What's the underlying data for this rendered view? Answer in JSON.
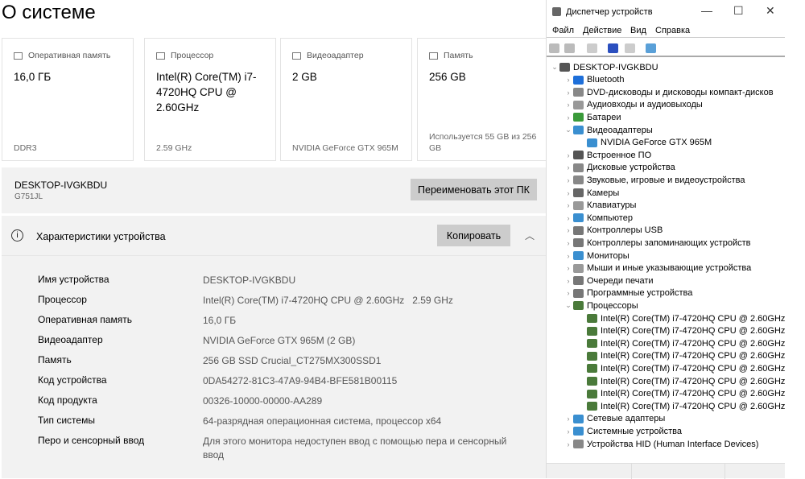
{
  "about": {
    "title": "О системе",
    "cards": [
      {
        "label": "Оперативная память",
        "value": "16,0 ГБ",
        "sub": "DDR3",
        "icon": "ram-icon"
      },
      {
        "label": "Процессор",
        "value": "Intel(R) Core(TM) i7-4720HQ CPU @ 2.60GHz",
        "sub": "2.59 GHz",
        "icon": "cpu-icon"
      },
      {
        "label": "Видеоадаптер",
        "value": "2 GB",
        "sub": "NVIDIA GeForce GTX 965M",
        "icon": "gpu-icon"
      },
      {
        "label": "Память",
        "value": "256 GB",
        "sub": "Используется 55 GB из 256 GB",
        "icon": "storage-icon"
      }
    ],
    "pc_name": "DESKTOP-IVGKBDU",
    "model": "G751JL",
    "rename_label": "Переименовать этот ПК",
    "spec_title": "Характеристики устройства",
    "copy_label": "Копировать",
    "specs": [
      {
        "k": "Имя устройства",
        "v": "DESKTOP-IVGKBDU"
      },
      {
        "k": "Процессор",
        "v": "Intel(R) Core(TM) i7-4720HQ CPU @ 2.60GHz   2.59 GHz"
      },
      {
        "k": "Оперативная память",
        "v": "16,0 ГБ"
      },
      {
        "k": "Видеоадаптер",
        "v": "NVIDIA GeForce GTX 965M (2 GB)"
      },
      {
        "k": "Память",
        "v": "256 GB SSD Crucial_CT275MX300SSD1"
      },
      {
        "k": "Код устройства",
        "v": "0DA54272-81C3-47A9-94B4-BFE581B00115"
      },
      {
        "k": "Код продукта",
        "v": "00326-10000-00000-AA289"
      },
      {
        "k": "Тип системы",
        "v": "64-разрядная операционная система, процессор x64"
      },
      {
        "k": "Перо и сенсорный ввод",
        "v": "Для этого монитора недоступен ввод с помощью пера и сенсорный ввод"
      }
    ]
  },
  "devmgr": {
    "title": "Диспетчер устройств",
    "menu": [
      "Файл",
      "Действие",
      "Вид",
      "Справка"
    ],
    "tree": [
      {
        "t": "DESKTOP-IVGKBDU",
        "l": 0,
        "e": "v",
        "c": "#555"
      },
      {
        "t": "Bluetooth",
        "l": 1,
        "e": ">",
        "c": "#1e6fd9"
      },
      {
        "t": "DVD-дисководы и дисководы компакт-дисков",
        "l": 1,
        "e": ">",
        "c": "#888"
      },
      {
        "t": "Аудиовходы и аудиовыходы",
        "l": 1,
        "e": ">",
        "c": "#999"
      },
      {
        "t": "Батареи",
        "l": 1,
        "e": ">",
        "c": "#3a9a3a"
      },
      {
        "t": "Видеоадаптеры",
        "l": 1,
        "e": "v",
        "c": "#3a8fd0"
      },
      {
        "t": "NVIDIA GeForce GTX 965M",
        "l": 2,
        "e": "",
        "c": "#3a8fd0"
      },
      {
        "t": "Встроенное ПО",
        "l": 1,
        "e": ">",
        "c": "#555"
      },
      {
        "t": "Дисковые устройства",
        "l": 1,
        "e": ">",
        "c": "#888"
      },
      {
        "t": "Звуковые, игровые и видеоустройства",
        "l": 1,
        "e": ">",
        "c": "#888"
      },
      {
        "t": "Камеры",
        "l": 1,
        "e": ">",
        "c": "#666"
      },
      {
        "t": "Клавиатуры",
        "l": 1,
        "e": ">",
        "c": "#999"
      },
      {
        "t": "Компьютер",
        "l": 1,
        "e": ">",
        "c": "#3a8fd0"
      },
      {
        "t": "Контроллеры USB",
        "l": 1,
        "e": ">",
        "c": "#777"
      },
      {
        "t": "Контроллеры запоминающих устройств",
        "l": 1,
        "e": ">",
        "c": "#777"
      },
      {
        "t": "Мониторы",
        "l": 1,
        "e": ">",
        "c": "#3a8fd0"
      },
      {
        "t": "Мыши и иные указывающие устройства",
        "l": 1,
        "e": ">",
        "c": "#999"
      },
      {
        "t": "Очереди печати",
        "l": 1,
        "e": ">",
        "c": "#777"
      },
      {
        "t": "Программные устройства",
        "l": 1,
        "e": ">",
        "c": "#777"
      },
      {
        "t": "Процессоры",
        "l": 1,
        "e": "v",
        "c": "#4a7a3a"
      },
      {
        "t": "Intel(R) Core(TM) i7-4720HQ CPU @ 2.60GHz",
        "l": 2,
        "e": "",
        "c": "#4a7a3a"
      },
      {
        "t": "Intel(R) Core(TM) i7-4720HQ CPU @ 2.60GHz",
        "l": 2,
        "e": "",
        "c": "#4a7a3a"
      },
      {
        "t": "Intel(R) Core(TM) i7-4720HQ CPU @ 2.60GHz",
        "l": 2,
        "e": "",
        "c": "#4a7a3a"
      },
      {
        "t": "Intel(R) Core(TM) i7-4720HQ CPU @ 2.60GHz",
        "l": 2,
        "e": "",
        "c": "#4a7a3a"
      },
      {
        "t": "Intel(R) Core(TM) i7-4720HQ CPU @ 2.60GHz",
        "l": 2,
        "e": "",
        "c": "#4a7a3a"
      },
      {
        "t": "Intel(R) Core(TM) i7-4720HQ CPU @ 2.60GHz",
        "l": 2,
        "e": "",
        "c": "#4a7a3a"
      },
      {
        "t": "Intel(R) Core(TM) i7-4720HQ CPU @ 2.60GHz",
        "l": 2,
        "e": "",
        "c": "#4a7a3a"
      },
      {
        "t": "Intel(R) Core(TM) i7-4720HQ CPU @ 2.60GHz",
        "l": 2,
        "e": "",
        "c": "#4a7a3a"
      },
      {
        "t": "Сетевые адаптеры",
        "l": 1,
        "e": ">",
        "c": "#3a8fd0"
      },
      {
        "t": "Системные устройства",
        "l": 1,
        "e": ">",
        "c": "#3a8fd0"
      },
      {
        "t": "Устройства HID (Human Interface Devices)",
        "l": 1,
        "e": ">",
        "c": "#888"
      }
    ]
  }
}
